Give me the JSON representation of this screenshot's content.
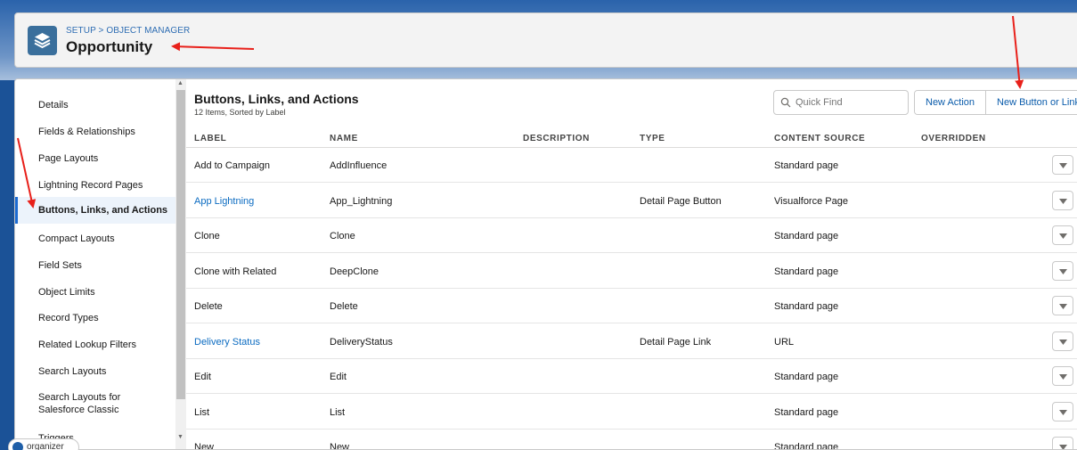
{
  "header": {
    "breadcrumb": "SETUP > OBJECT MANAGER",
    "title": "Opportunity",
    "icon": "layers-icon"
  },
  "sidebar": {
    "items": [
      {
        "label": "Details",
        "active": false
      },
      {
        "label": "Fields & Relationships",
        "active": false
      },
      {
        "label": "Page Layouts",
        "active": false
      },
      {
        "label": "Lightning Record Pages",
        "active": false
      },
      {
        "label": "Buttons, Links, and Actions",
        "active": true
      },
      {
        "label": "Compact Layouts",
        "active": false
      },
      {
        "label": "Field Sets",
        "active": false
      },
      {
        "label": "Object Limits",
        "active": false
      },
      {
        "label": "Record Types",
        "active": false
      },
      {
        "label": "Related Lookup Filters",
        "active": false
      },
      {
        "label": "Search Layouts",
        "active": false
      },
      {
        "label": "Search Layouts for",
        "label2": "Salesforce Classic",
        "active": false
      },
      {
        "label": "Triggers",
        "active": false
      }
    ]
  },
  "section": {
    "title": "Buttons, Links, and Actions",
    "subtitle": "12 Items, Sorted by Label"
  },
  "search": {
    "placeholder": "Quick Find"
  },
  "toolbar": {
    "new_action": "New Action",
    "new_button": "New Button or Link"
  },
  "table": {
    "headers": [
      "LABEL",
      "NAME",
      "DESCRIPTION",
      "TYPE",
      "CONTENT SOURCE",
      "OVERRIDDEN"
    ],
    "rows": [
      {
        "label": "Add to Campaign",
        "name": "AddInfluence",
        "description": "",
        "type": "",
        "source": "Standard page",
        "link": false
      },
      {
        "label": "App Lightning",
        "name": "App_Lightning",
        "description": "",
        "type": "Detail Page Button",
        "source": "Visualforce Page",
        "link": true
      },
      {
        "label": "Clone",
        "name": "Clone",
        "description": "",
        "type": "",
        "source": "Standard page",
        "link": false
      },
      {
        "label": "Clone with Related",
        "name": "DeepClone",
        "description": "",
        "type": "",
        "source": "Standard page",
        "link": false
      },
      {
        "label": "Delete",
        "name": "Delete",
        "description": "",
        "type": "",
        "source": "Standard page",
        "link": false
      },
      {
        "label": "Delivery Status",
        "name": "DeliveryStatus",
        "description": "",
        "type": "Detail Page Link",
        "source": "URL",
        "link": true
      },
      {
        "label": "Edit",
        "name": "Edit",
        "description": "",
        "type": "",
        "source": "Standard page",
        "link": false
      },
      {
        "label": "List",
        "name": "List",
        "description": "",
        "type": "",
        "source": "Standard page",
        "link": false
      },
      {
        "label": "New",
        "name": "New",
        "description": "",
        "type": "",
        "source": "Standard page",
        "link": false
      }
    ]
  },
  "organizer": {
    "label": "organizer"
  },
  "colors": {
    "accent": "#0b6bc1",
    "annotation_arrow": "#e8201a",
    "banner": "#1b5297"
  }
}
